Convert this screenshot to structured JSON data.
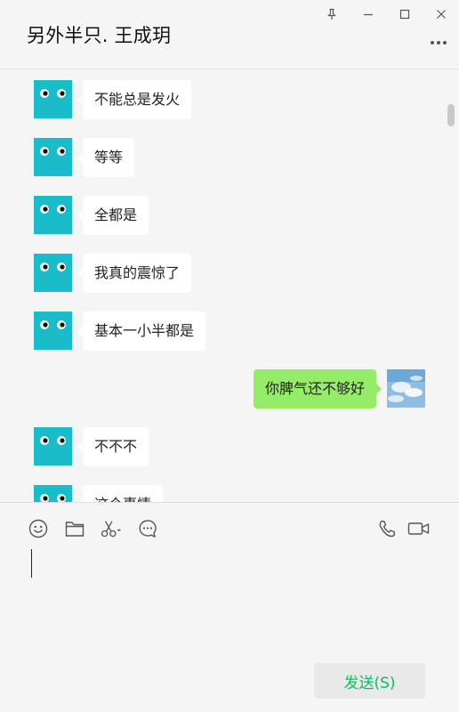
{
  "window": {
    "controls": [
      "pin-icon",
      "minimize-icon",
      "maximize-icon",
      "close-icon"
    ]
  },
  "chat": {
    "title": "另外半只. 王成玥",
    "more_icon": "more-icon",
    "messages": [
      {
        "side": "left",
        "text": "不能总是发火"
      },
      {
        "side": "left",
        "text": "等等"
      },
      {
        "side": "left",
        "text": "全都是"
      },
      {
        "side": "left",
        "text": "我真的震惊了"
      },
      {
        "side": "left",
        "text": "基本一小半都是"
      },
      {
        "side": "right",
        "text": "你脾气还不够好"
      },
      {
        "side": "left",
        "text": "不不不"
      },
      {
        "side": "left",
        "text": "这个事情"
      }
    ]
  },
  "composer": {
    "tools_left": [
      "emoji-icon",
      "folder-icon",
      "scissors-icon",
      "chat-history-icon"
    ],
    "tools_right": [
      "phone-icon",
      "video-icon"
    ],
    "send_label": "发送(S)"
  },
  "colors": {
    "background": "#f5f5f5",
    "own_bubble": "#95ec69",
    "other_bubble": "#ffffff",
    "avatar_teal": "#19bcc8",
    "send_text": "#07c160"
  }
}
